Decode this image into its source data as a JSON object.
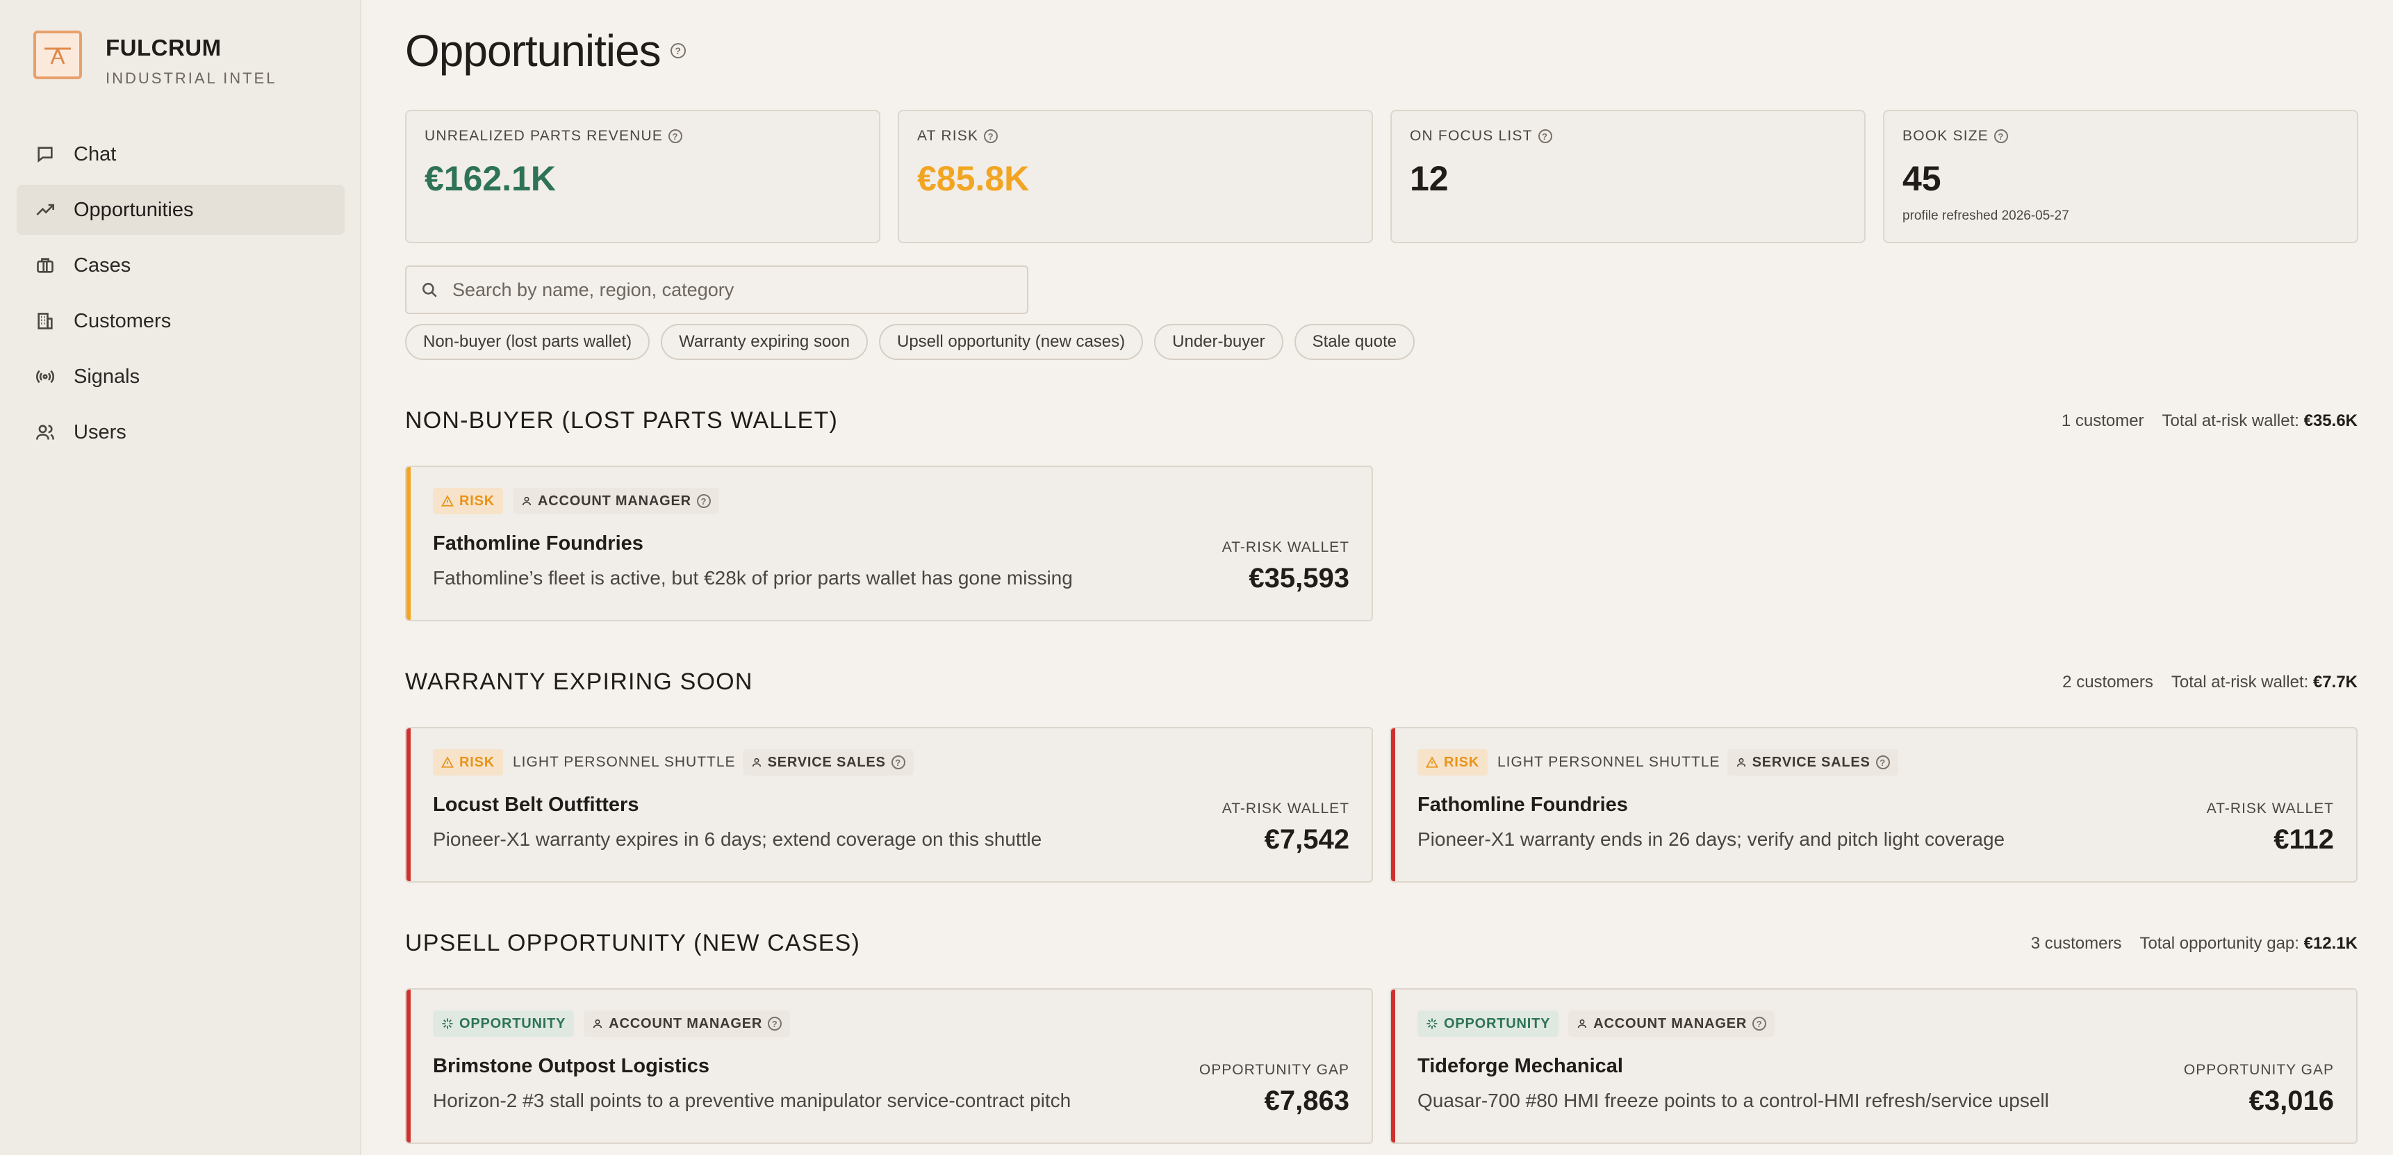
{
  "brand": {
    "name": "FULCRUM",
    "subtitle": "INDUSTRIAL INTEL"
  },
  "nav": [
    {
      "label": "Chat",
      "icon": "chat-icon",
      "active": false
    },
    {
      "label": "Opportunities",
      "icon": "trending-up-icon",
      "active": true
    },
    {
      "label": "Cases",
      "icon": "briefcase-icon",
      "active": false
    },
    {
      "label": "Customers",
      "icon": "building-icon",
      "active": false
    },
    {
      "label": "Signals",
      "icon": "broadcast-icon",
      "active": false
    },
    {
      "label": "Users",
      "icon": "users-icon",
      "active": false
    }
  ],
  "page": {
    "title": "Opportunities"
  },
  "stats": [
    {
      "label": "UNREALIZED PARTS REVENUE",
      "value": "€162.1K",
      "color": "#2e7355"
    },
    {
      "label": "AT RISK",
      "value": "€85.8K",
      "color": "#f2a522"
    },
    {
      "label": "ON FOCUS LIST",
      "value": "12",
      "color": "#1f1c19"
    },
    {
      "label": "BOOK SIZE",
      "value": "45",
      "note": "profile refreshed 2026-05-27",
      "color": "#1f1c19"
    }
  ],
  "search": {
    "placeholder": "Search by name, region, category",
    "value": ""
  },
  "chips": [
    "Non-buyer (lost parts wallet)",
    "Warranty expiring soon",
    "Upsell opportunity (new cases)",
    "Under-buyer",
    "Stale quote"
  ],
  "sections": [
    {
      "title": "NON-BUYER (LOST PARTS WALLET)",
      "count": "1 customer",
      "total_label": "Total at-risk wallet:",
      "total_value": "€35.6K",
      "cards": [
        {
          "tag": "RISK",
          "tag_kind": "risk",
          "product": "",
          "role": "ACCOUNT MANAGER",
          "name": "Fathomline Foundries",
          "desc": "Fathomline’s fleet is active, but €28k of prior parts wallet has gone missing",
          "amount_label": "AT-RISK WALLET",
          "amount": "€35,593",
          "accent": "#f2a522"
        }
      ]
    },
    {
      "title": "WARRANTY EXPIRING SOON",
      "count": "2 customers",
      "total_label": "Total at-risk wallet:",
      "total_value": "€7.7K",
      "cards": [
        {
          "tag": "RISK",
          "tag_kind": "risk",
          "product": "LIGHT PERSONNEL SHUTTLE",
          "role": "SERVICE SALES",
          "name": "Locust Belt Outfitters",
          "desc": "Pioneer-X1 warranty expires in 6 days; extend coverage on this shuttle",
          "amount_label": "AT-RISK WALLET",
          "amount": "€7,542",
          "accent": "#d0312d"
        },
        {
          "tag": "RISK",
          "tag_kind": "risk",
          "product": "LIGHT PERSONNEL SHUTTLE",
          "role": "SERVICE SALES",
          "name": "Fathomline Foundries",
          "desc": "Pioneer-X1 warranty ends in 26 days; verify and pitch light coverage",
          "amount_label": "AT-RISK WALLET",
          "amount": "€112",
          "accent": "#d0312d"
        }
      ]
    },
    {
      "title": "UPSELL OPPORTUNITY (NEW CASES)",
      "count": "3 customers",
      "total_label": "Total opportunity gap:",
      "total_value": "€12.1K",
      "cards": [
        {
          "tag": "OPPORTUNITY",
          "tag_kind": "opp",
          "product": "",
          "role": "ACCOUNT MANAGER",
          "name": "Brimstone Outpost Logistics",
          "desc": "Horizon-2 #3 stall points to a preventive manipulator service-contract pitch",
          "amount_label": "OPPORTUNITY GAP",
          "amount": "€7,863",
          "accent": "#d0312d"
        },
        {
          "tag": "OPPORTUNITY",
          "tag_kind": "opp",
          "product": "",
          "role": "ACCOUNT MANAGER",
          "name": "Tideforge Mechanical",
          "desc": "Quasar-700 #80 HMI freeze points to a control-HMI refresh/service upsell",
          "amount_label": "OPPORTUNITY GAP",
          "amount": "€3,016",
          "accent": "#d0312d"
        }
      ]
    }
  ]
}
